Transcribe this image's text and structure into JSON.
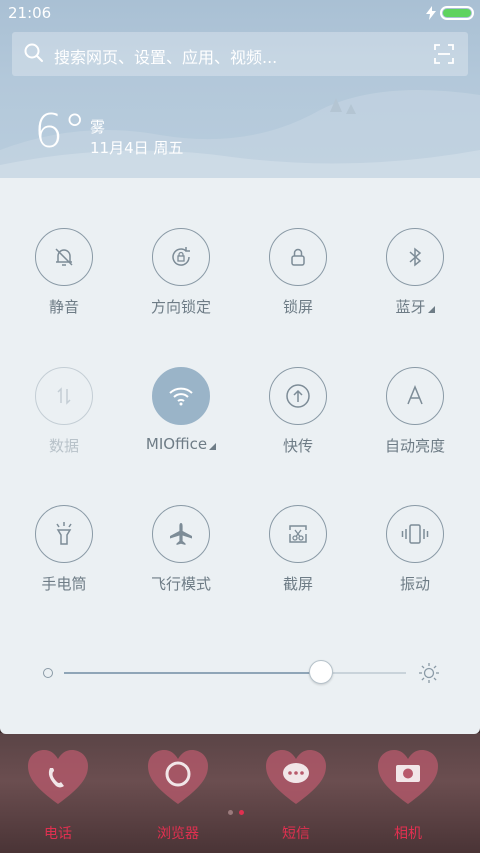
{
  "status_bar": {
    "time": "21:06",
    "battery_level": 1.0,
    "charging_icon": "bolt-icon"
  },
  "search": {
    "placeholder": "搜索网页、设置、应用、视频...",
    "search_icon": "search-icon",
    "scan_icon": "scan-icon"
  },
  "weather": {
    "temperature": "6°",
    "condition": "雾",
    "date": "11月4日 周五"
  },
  "quick_settings": {
    "tiles": [
      {
        "label": "静音",
        "icon": "bell-off-icon",
        "state": "off"
      },
      {
        "label": "方向锁定",
        "icon": "rotation-lock-icon",
        "state": "off"
      },
      {
        "label": "锁屏",
        "icon": "lock-icon",
        "state": "off"
      },
      {
        "label": "蓝牙",
        "icon": "bluetooth-icon",
        "state": "off",
        "has_menu": true
      },
      {
        "label": "数据",
        "icon": "data-arrows-icon",
        "state": "disabled"
      },
      {
        "label": "MIOffice",
        "icon": "wifi-icon",
        "state": "on",
        "has_menu": true
      },
      {
        "label": "快传",
        "icon": "upload-icon",
        "state": "off"
      },
      {
        "label": "自动亮度",
        "icon": "auto-brightness-icon",
        "state": "off"
      },
      {
        "label": "手电筒",
        "icon": "flashlight-icon",
        "state": "off"
      },
      {
        "label": "飞行模式",
        "icon": "airplane-icon",
        "state": "off"
      },
      {
        "label": "截屏",
        "icon": "screenshot-icon",
        "state": "off"
      },
      {
        "label": "振动",
        "icon": "vibrate-icon",
        "state": "off"
      }
    ],
    "brightness": 0.75
  },
  "home_dock": {
    "items": [
      {
        "label": "电话",
        "icon": "phone-icon"
      },
      {
        "label": "浏览器",
        "icon": "browser-icon"
      },
      {
        "label": "短信",
        "icon": "message-icon"
      },
      {
        "label": "相机",
        "icon": "camera-icon"
      }
    ],
    "accent_color": "#e03050"
  },
  "colors": {
    "panel_bg": "#ebf0f3",
    "tile_border": "#8a9aa6",
    "tile_active": "#9ab4c8",
    "label": "#6e7c86"
  }
}
